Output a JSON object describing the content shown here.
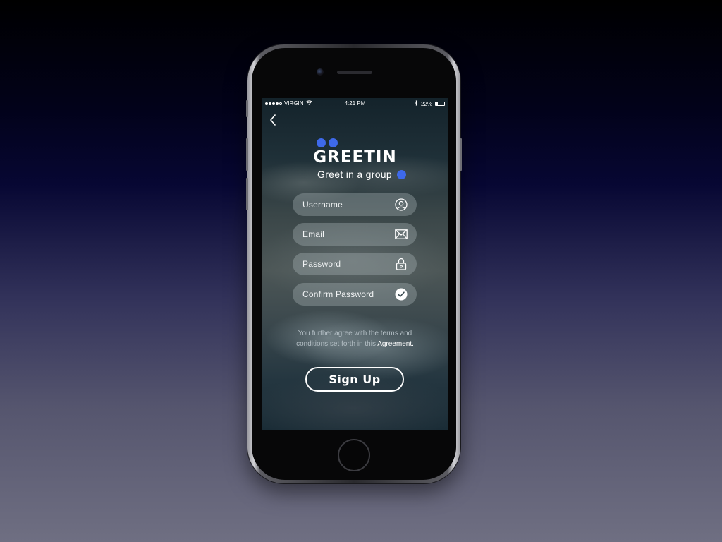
{
  "status_bar": {
    "carrier": "VIRGIN",
    "time": "4:21 PM",
    "battery_text": "22%",
    "battery_level": 0.22,
    "signal_bars_filled": 4,
    "signal_bars_total": 5,
    "icons": [
      "wifi-icon",
      "bluetooth-icon",
      "battery-icon"
    ]
  },
  "nav": {
    "back_icon": "chevron-left-icon"
  },
  "brand": {
    "title": "GREETIN",
    "subtitle": "Greet in a group",
    "accent_color": "#3e69ea"
  },
  "form": {
    "username": {
      "placeholder": "Username",
      "value": "",
      "icon": "user-circle-icon"
    },
    "email": {
      "placeholder": "Email",
      "value": "",
      "icon": "envelope-icon"
    },
    "password": {
      "placeholder": "Password",
      "value": "",
      "icon": "lock-icon"
    },
    "confirm_password": {
      "placeholder": "Confirm Password",
      "value": "",
      "icon": "check-circle-icon"
    }
  },
  "terms": {
    "line1": "You further agree with the terms and",
    "line2_prefix": "conditions set forth in this ",
    "link_text": "Agreement."
  },
  "signup": {
    "label": "Sign Up"
  },
  "colors": {
    "background_top": "#000000",
    "background_bottom": "#6f6f82",
    "field_fill": "rgba(175,185,190,0.35)",
    "text": "#ffffff"
  }
}
